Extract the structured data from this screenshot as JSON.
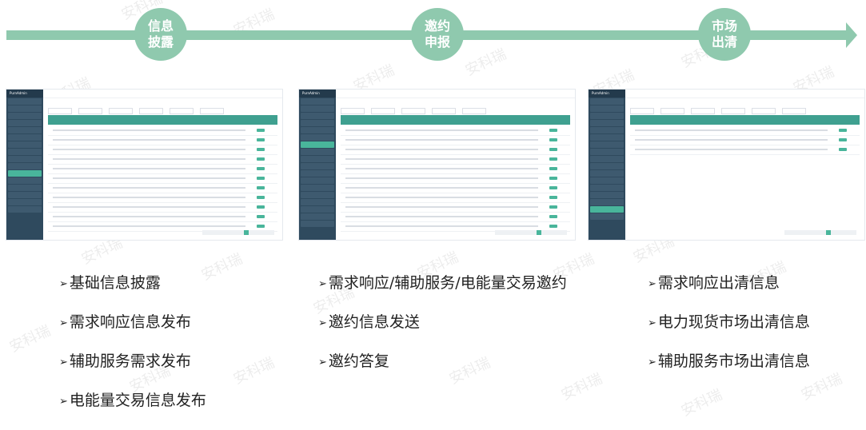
{
  "colors": {
    "arrow": "#8fc9ae",
    "stage_circle": "#8fc9ae",
    "stage_text": "#ffffff",
    "accent": "#3fa090"
  },
  "watermark": "安科瑞",
  "stages": [
    {
      "label_line1": "信息",
      "label_line2": "披露"
    },
    {
      "label_line1": "邀约",
      "label_line2": "申报"
    },
    {
      "label_line1": "市场",
      "label_line2": "出清"
    }
  ],
  "screenshots": [
    {
      "app_name": "PurnAdmin"
    },
    {
      "app_name": "PurnAdmin"
    },
    {
      "app_name": "PurnAdmin"
    }
  ],
  "bullet_symbol": "➢",
  "lists": [
    {
      "items": [
        "基础信息披露",
        "需求响应信息发布",
        "辅助服务需求发布",
        "电能量交易信息发布"
      ]
    },
    {
      "items": [
        "需求响应/辅助服务/电能量交易邀约",
        "邀约信息发送",
        "邀约答复"
      ]
    },
    {
      "items": [
        "需求响应出清信息",
        "电力现货市场出清信息",
        "辅助服务市场出清信息"
      ]
    }
  ]
}
